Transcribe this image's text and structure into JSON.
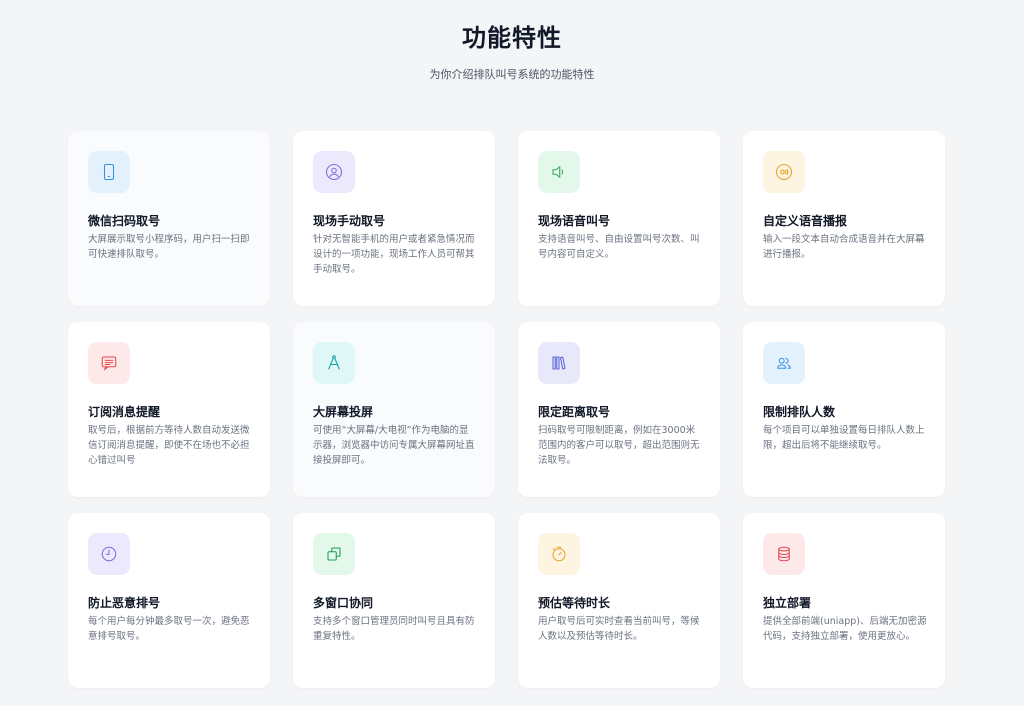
{
  "header": {
    "title": "功能特性",
    "subtitle": "为你介绍排队叫号系统的功能特性"
  },
  "features": [
    {
      "title": "微信扫码取号",
      "desc": "大屏展示取号小程序码，用户扫一扫即可快速排队取号。",
      "icon": "phone-icon",
      "bg": "#e3f1fd",
      "color": "#3b8fe0"
    },
    {
      "title": "现场手动取号",
      "desc": "针对无智能手机的用户或者紧急情况而设计的一项功能，现场工作人员可帮其手动取号。",
      "icon": "user-circle-icon",
      "bg": "#ece9fc",
      "color": "#7c6be0"
    },
    {
      "title": "现场语音叫号",
      "desc": "支持语音叫号、自由设置叫号次数、叫号内容可自定义。",
      "icon": "speaker-icon",
      "bg": "#e3f7ea",
      "color": "#34a853"
    },
    {
      "title": "自定义语音播报",
      "desc": "输入一段文本自动合成语音并在大屏幕进行播报。",
      "icon": "broadcast-icon",
      "bg": "#fdf4e1",
      "color": "#e4a326"
    },
    {
      "title": "订阅消息提醒",
      "desc": "取号后，根据前方等待人数自动发送微信订阅消息提醒，即使不在场也不必担心错过叫号",
      "icon": "message-icon",
      "bg": "#fde8ea",
      "color": "#e5484d"
    },
    {
      "title": "大屏幕投屏",
      "desc": "可使用“大屏幕/大电视”作为电脑的显示器，浏览器中访问专属大屏幕网址直接投屏即可。",
      "icon": "compass-icon",
      "bg": "#e0f7f7",
      "color": "#14a3a3"
    },
    {
      "title": "限定距离取号",
      "desc": "扫码取号可限制距离，例如在3000米范围内的客户可以取号，超出范围则无法取号。",
      "icon": "library-icon",
      "bg": "#e7e9fb",
      "color": "#5b63d3"
    },
    {
      "title": "限制排队人数",
      "desc": "每个项目可以单独设置每日排队人数上限，超出后将不能继续取号。",
      "icon": "users-icon",
      "bg": "#e3f1fd",
      "color": "#3b8fe0"
    },
    {
      "title": "防止恶意排号",
      "desc": "每个用户每分钟最多取号一次，避免恶意排号取号。",
      "icon": "clock-icon",
      "bg": "#ece9fc",
      "color": "#7c6be0"
    },
    {
      "title": "多窗口协同",
      "desc": "支持多个窗口管理员同时叫号且具有防重复特性。",
      "icon": "windows-icon",
      "bg": "#e3f7ea",
      "color": "#1f9d55"
    },
    {
      "title": "预估等待时长",
      "desc": "用户取号后可实时查看当前叫号，等候人数以及预估等待时长。",
      "icon": "timer-icon",
      "bg": "#fdf4e1",
      "color": "#e4a326"
    },
    {
      "title": "独立部署",
      "desc": "提供全部前端(uniapp)、后端无加密源代码，支持独立部署，使用更放心。",
      "icon": "database-icon",
      "bg": "#fde8ea",
      "color": "#e5484d"
    }
  ]
}
